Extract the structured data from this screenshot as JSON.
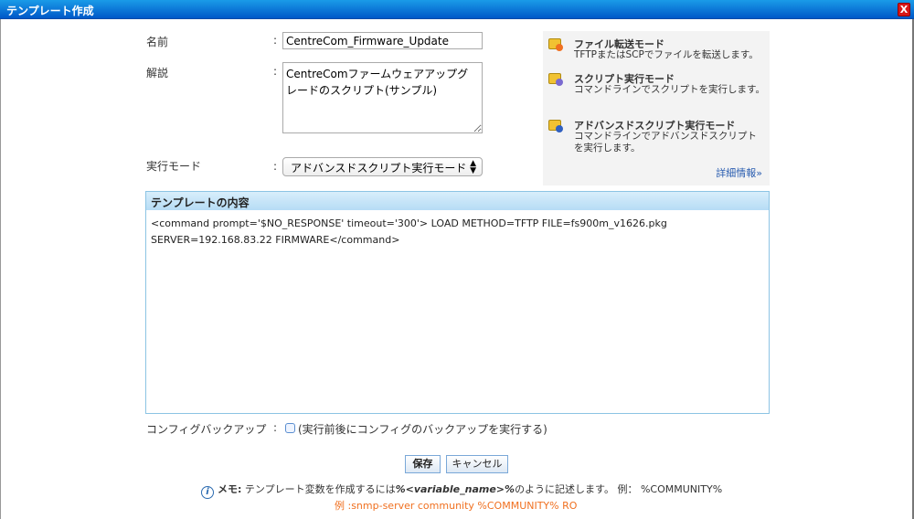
{
  "window": {
    "title": "テンプレート作成",
    "close_label": "X"
  },
  "form": {
    "name_label": "名前",
    "name_value": "CentreCom_Firmware_Update",
    "desc_label": "解説",
    "desc_value": "CentreComファームウェアアップグレードのスクリプト(サンプル)",
    "mode_label": "実行モード",
    "mode_value": "アドバンスドスクリプト実行モード",
    "colon": ":"
  },
  "modes": [
    {
      "title": "ファイル転送モード",
      "desc": "TFTPまたはSCPでファイルを転送します。"
    },
    {
      "title": "スクリプト実行モード",
      "desc": "コマンドラインでスクリプトを実行します。"
    },
    {
      "title": "アドバンスドスクリプト実行モード",
      "desc": "コマンドラインでアドバンスドスクリプトを実行します。"
    }
  ],
  "more_info": "詳細情報»",
  "template": {
    "header": "テンプレートの内容",
    "line1": "<command prompt='$NO_RESPONSE' timeout='300'> LOAD METHOD=TFTP FILE=fs900m_v1626.pkg",
    "line2": "SERVER=192.168.83.22 FIRMWARE</command>"
  },
  "backup": {
    "label": "コンフィグバックアップ",
    "checkbox_label": "(実行前後にコンフィグのバックアップを実行する)",
    "checked": false
  },
  "buttons": {
    "save": "保存",
    "cancel": "キャンセル"
  },
  "memo": {
    "prefix": "メモ:",
    "text1": "テンプレート変数を作成するには",
    "variable": "%<variable_name>%",
    "text2": "のように記述します。 例： %COMMUNITY%",
    "example": "例 :snmp-server community %COMMUNITY% RO"
  },
  "colors": {
    "titlebar": "#0a6fd8",
    "example": "#f07020",
    "link": "#2a5db0"
  }
}
